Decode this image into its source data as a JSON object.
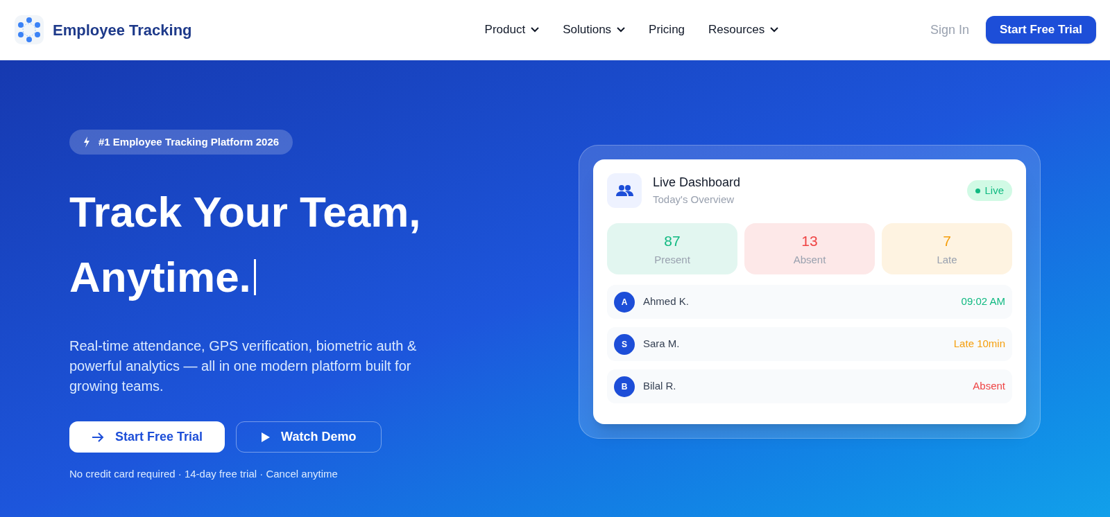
{
  "header": {
    "brand": "Employee Tracking",
    "nav": [
      {
        "label": "Product",
        "dropdown": true
      },
      {
        "label": "Solutions",
        "dropdown": true
      },
      {
        "label": "Pricing",
        "dropdown": false
      },
      {
        "label": "Resources",
        "dropdown": true
      }
    ],
    "sign_in": "Sign In",
    "cta": "Start Free Trial"
  },
  "hero": {
    "badge": "#1 Employee Tracking Platform 2026",
    "headline_lines": [
      "Track Your Team,",
      "Anytime."
    ],
    "cursor": true,
    "description": "Real-time attendance, GPS verification, biometric auth & powerful analytics — all in one modern platform built for growing teams.",
    "primary_button": "Start Free Trial",
    "secondary_button": "Watch Demo",
    "note": "No credit card required · 14-day free trial · Cancel anytime"
  },
  "dashboard": {
    "title": "Live Dashboard",
    "subtitle": "Today's Overview",
    "status": "Live",
    "stats": [
      {
        "value": "87",
        "label": "Present",
        "color": "#10b981"
      },
      {
        "value": "13",
        "label": "Absent",
        "color": "#ef4444"
      },
      {
        "value": "7",
        "label": "Late",
        "color": "#f59e0b"
      }
    ],
    "employees": [
      {
        "initial": "A",
        "name": "Ahmed K.",
        "status": "09:02 AM",
        "color": "#10b981"
      },
      {
        "initial": "S",
        "name": "Sara M.",
        "status": "Late 10min",
        "color": "#f59e0b"
      },
      {
        "initial": "B",
        "name": "Bilal R.",
        "status": "Absent",
        "color": "#ef4444"
      }
    ]
  }
}
